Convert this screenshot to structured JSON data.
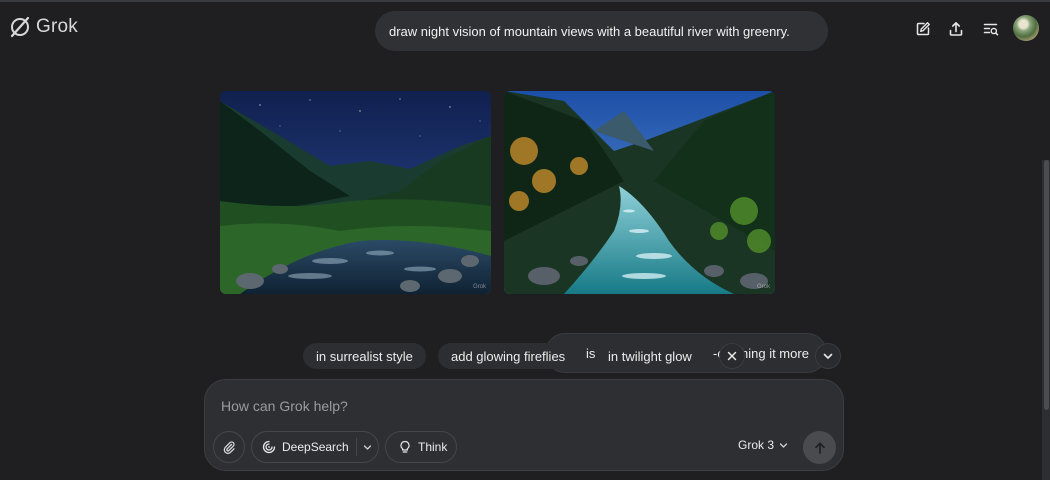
{
  "app": {
    "name": "Grok"
  },
  "header": {
    "user_prompt": "draw night vision of mountain views with a beautiful river with greenry.",
    "icons": [
      "edit-icon",
      "share-icon",
      "history-icon",
      "avatar"
    ]
  },
  "images": [
    {
      "description": "night mountain valley with stream",
      "watermark": "Grok"
    },
    {
      "description": "dusk mountain river with glowing water",
      "watermark": "Grok"
    }
  ],
  "suggestions": {
    "chips": [
      "in surrealist style",
      "add glowing fireflies",
      "in twilight glow"
    ],
    "ghost_text_a": "is",
    "ghost_text_b": "-c",
    "ghost_text_c": "hing it more"
  },
  "composer": {
    "placeholder": "How can Grok help?",
    "deepsearch_label": "DeepSearch",
    "think_label": "Think",
    "model_label": "Grok 3"
  },
  "colors": {
    "background": "#1f1f21",
    "surface": "#2e2f33",
    "chip": "#2d2e31",
    "text": "#ececee",
    "muted": "#9a9b9f"
  }
}
